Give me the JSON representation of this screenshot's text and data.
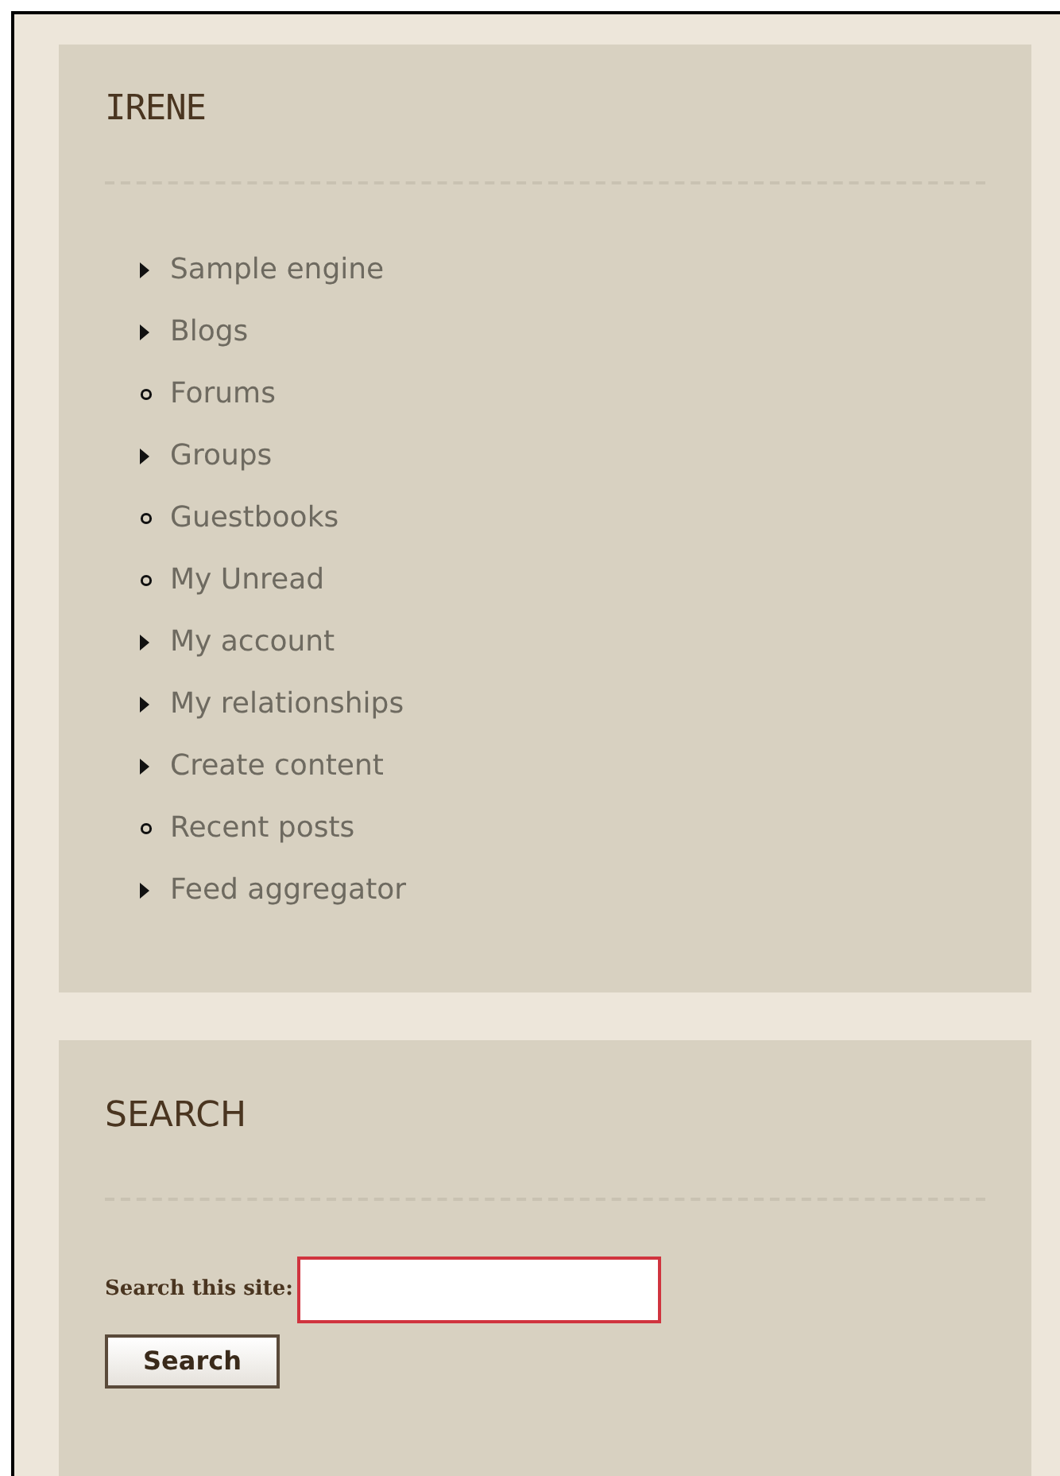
{
  "navigation": {
    "title": "IRENE",
    "items": [
      {
        "label": "Sample engine",
        "kind": "collapsed"
      },
      {
        "label": "Blogs",
        "kind": "collapsed"
      },
      {
        "label": "Forums",
        "kind": "leaf"
      },
      {
        "label": "Groups",
        "kind": "collapsed"
      },
      {
        "label": "Guestbooks",
        "kind": "leaf"
      },
      {
        "label": "My Unread",
        "kind": "leaf"
      },
      {
        "label": "My account",
        "kind": "collapsed"
      },
      {
        "label": "My relationships",
        "kind": "collapsed"
      },
      {
        "label": "Create content",
        "kind": "collapsed"
      },
      {
        "label": "Recent posts",
        "kind": "leaf"
      },
      {
        "label": "Feed aggregator",
        "kind": "collapsed"
      }
    ]
  },
  "search": {
    "title": "SEARCH",
    "field_label": "Search this site:",
    "button": "Search"
  }
}
